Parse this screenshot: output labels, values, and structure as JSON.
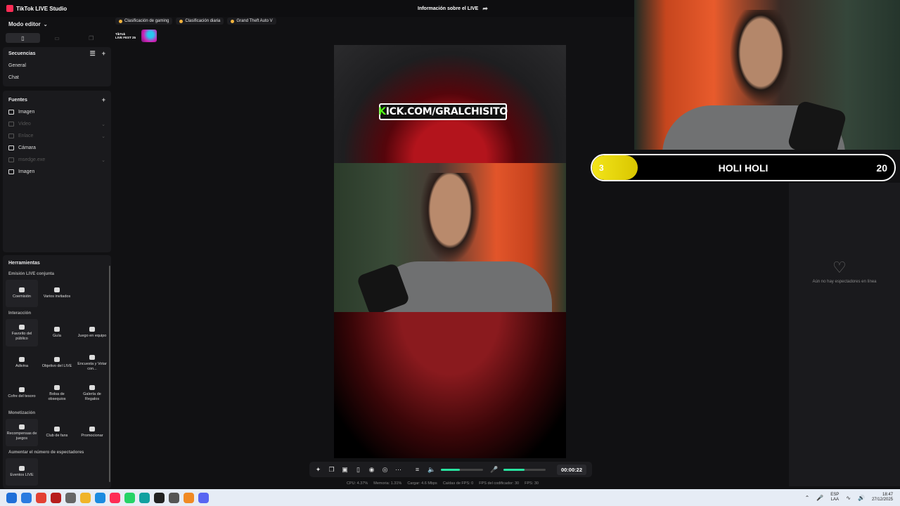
{
  "titlebar": {
    "app_title": "TikTok LIVE Studio",
    "live_info": "Información sobre el LIVE"
  },
  "left": {
    "editor_mode": "Modo editor",
    "sequences": {
      "title": "Secuencias",
      "items": [
        "General",
        "Chat"
      ]
    },
    "sources": {
      "title": "Fuentes",
      "items": [
        {
          "label": "Imagen",
          "dim": false,
          "icon": "image-icon"
        },
        {
          "label": "Video",
          "dim": true,
          "icon": "video-icon"
        },
        {
          "label": "Enlace",
          "dim": true,
          "icon": "link-icon"
        },
        {
          "label": "Cámara",
          "dim": false,
          "icon": "camera-icon"
        },
        {
          "label": "msedge.exe",
          "dim": true,
          "icon": "window-icon"
        },
        {
          "label": "Imagen",
          "dim": false,
          "icon": "image-icon"
        }
      ]
    },
    "tools": {
      "title": "Herramientas",
      "sections": [
        {
          "title": "Emisión LIVE conjunta",
          "items": [
            "Coemisión",
            "Varios invitados"
          ]
        },
        {
          "title": "Interacción",
          "items": [
            "Favorito del público",
            "Guía",
            "Juego en equipo",
            "Adivina",
            "Objetivo del LIVE",
            "Encuesta y Votar con...",
            "Cofre del tesoro",
            "Bolsa de obsequios",
            "Galería de Regalos"
          ]
        },
        {
          "title": "Monetización",
          "items": [
            "Recompensas de juegos",
            "Club de fans",
            "Promocionar"
          ]
        },
        {
          "title": "Aumentar el número de espectadores",
          "items": [
            "Eventos LIVE"
          ]
        }
      ]
    }
  },
  "chips": [
    "Clasificación de gaming",
    "Clasificación diaria",
    "Grand Theft Auto V"
  ],
  "event_badge": {
    "line1": "TikTok",
    "line2": "LIVE FEST 25"
  },
  "preview": {
    "kick_k": "K",
    "kick_text": "ICK.COM/GRALCHISITO"
  },
  "controls": {
    "timer": "00:00:22",
    "speaker_level": 0.45,
    "mic_level": 0.5
  },
  "stats": [
    "CPU: 4.37%",
    "Memoria: 1.31%",
    "Cargar: 4.6 Mbps",
    "Caídas de FPS: 0",
    "FPS del codificador: 30",
    "FPS: 30"
  ],
  "viewers": {
    "empty_text": "Aún no hay espectadores en línea"
  },
  "goal": {
    "current": "3",
    "title": "HOLI HOLI",
    "target": "20",
    "fill": 0.15
  },
  "taskbar": {
    "icons": [
      {
        "name": "windows-start-icon",
        "color": "#1f6fd8"
      },
      {
        "name": "copilot-icon",
        "color": "#2a7be0"
      },
      {
        "name": "chrome-icon",
        "color": "#e34133"
      },
      {
        "name": "record-icon",
        "color": "#b71c1c"
      },
      {
        "name": "settings-icon",
        "color": "#666"
      },
      {
        "name": "file-explorer-icon",
        "color": "#f0b429"
      },
      {
        "name": "edge-icon",
        "color": "#1b8be0"
      },
      {
        "name": "tiktok-studio-icon",
        "color": "#fe2c55"
      },
      {
        "name": "whatsapp-icon",
        "color": "#25d366"
      },
      {
        "name": "edge-beta-icon",
        "color": "#11a0a0"
      },
      {
        "name": "obs-icon",
        "color": "#222"
      },
      {
        "name": "app-icon",
        "color": "#555"
      },
      {
        "name": "vlc-icon",
        "color": "#f08a24"
      },
      {
        "name": "discord-icon",
        "color": "#5865f2"
      }
    ],
    "lang": {
      "line1": "ESP",
      "line2": "LAA"
    },
    "time": "18:47",
    "date": "27/12/2025"
  }
}
